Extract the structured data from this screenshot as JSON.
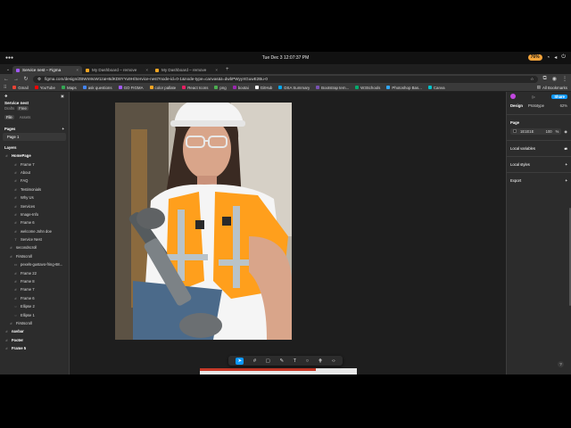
{
  "system": {
    "clock": "Tue Dec 3  12:07:37 PM",
    "battery": "76%"
  },
  "browser": {
    "tabs": [
      {
        "title": "Service nest – Figma",
        "favicon_color": "#a259ff",
        "active": true
      },
      {
        "title": "My Dashboard – remove",
        "favicon_color": "#f5a623",
        "active": false
      },
      {
        "title": "My Dashboard – remove",
        "favicon_color": "#f5a623",
        "active": false
      }
    ],
    "new_tab": "+",
    "url": "figma.com/design/ZBWm9oW1zaH6dKD8YYu9H/Service-nest?node-id=0-1&node-type=canvas&t=dwbPWyyXGuwE2Bu-0",
    "bookmarks": [
      {
        "label": "Gmail",
        "color": "#ea4335"
      },
      {
        "label": "YouTube",
        "color": "#ff0000"
      },
      {
        "label": "Maps",
        "color": "#34a853"
      },
      {
        "label": "ask questions",
        "color": "#4285f4"
      },
      {
        "label": "GO FIGMA",
        "color": "#a259ff"
      },
      {
        "label": "color pallate",
        "color": "#f5a623"
      },
      {
        "label": "React Icons",
        "color": "#e91e63"
      },
      {
        "label": "png",
        "color": "#4caf50"
      },
      {
        "label": "bootai",
        "color": "#9c27b0"
      },
      {
        "label": "GitHub",
        "color": "#ffffff"
      },
      {
        "label": "DSA Summary",
        "color": "#03a9f4"
      },
      {
        "label": "Bootstrap tem...",
        "color": "#7952b3"
      },
      {
        "label": "W3Schools",
        "color": "#04aa6d"
      },
      {
        "label": "Photoshop Bas...",
        "color": "#31a8ff"
      },
      {
        "label": "Canva",
        "color": "#00c4cc"
      }
    ],
    "all_bookmarks": "All Bookmarks"
  },
  "left_panel": {
    "file_name": "Service nest",
    "file_sub": "Drafts",
    "file_badge": "Free",
    "tabs": [
      "File",
      "Assets"
    ],
    "pages_label": "Pages",
    "pages_add": "+",
    "page": "Page 1",
    "layers_label": "Layers",
    "layers": [
      {
        "name": "HomePage",
        "indent": 0,
        "bold": true,
        "icon": "#"
      },
      {
        "name": "Frame 7",
        "indent": 2,
        "bold": false,
        "icon": "#"
      },
      {
        "name": "About",
        "indent": 2,
        "bold": false,
        "icon": "#"
      },
      {
        "name": "FAQ",
        "indent": 2,
        "bold": false,
        "icon": "#"
      },
      {
        "name": "Testimonials",
        "indent": 2,
        "bold": false,
        "icon": "#"
      },
      {
        "name": "Why Us",
        "indent": 2,
        "bold": false,
        "icon": "#"
      },
      {
        "name": "Services",
        "indent": 2,
        "bold": false,
        "icon": "#"
      },
      {
        "name": "Image-Info",
        "indent": 2,
        "bold": false,
        "icon": "#"
      },
      {
        "name": "Frame 6",
        "indent": 2,
        "bold": false,
        "icon": "#"
      },
      {
        "name": "welcome John doe",
        "indent": 2,
        "bold": false,
        "icon": "#"
      },
      {
        "name": "Service Nest",
        "indent": 2,
        "bold": false,
        "icon": "T"
      },
      {
        "name": "secondscroll",
        "indent": 1,
        "bold": false,
        "icon": "#"
      },
      {
        "name": "Firstscroll",
        "indent": 1,
        "bold": false,
        "icon": "#"
      },
      {
        "name": "pexels-gustavo-fring-68...",
        "indent": 2,
        "bold": false,
        "icon": "▭"
      },
      {
        "name": "Frame 22",
        "indent": 2,
        "bold": false,
        "icon": "#"
      },
      {
        "name": "Frame 8",
        "indent": 2,
        "bold": false,
        "icon": "#"
      },
      {
        "name": "Frame 7",
        "indent": 2,
        "bold": false,
        "icon": "#"
      },
      {
        "name": "Frame 6",
        "indent": 2,
        "bold": false,
        "icon": "#"
      },
      {
        "name": "Ellipse 2",
        "indent": 2,
        "bold": false,
        "icon": "○"
      },
      {
        "name": "Ellipse 1",
        "indent": 2,
        "bold": false,
        "icon": "○"
      },
      {
        "name": "Firstscroll",
        "indent": 1,
        "bold": false,
        "icon": "#"
      },
      {
        "name": "navbar",
        "indent": 0,
        "bold": true,
        "icon": "#"
      },
      {
        "name": "Footer",
        "indent": 0,
        "bold": true,
        "icon": "#"
      },
      {
        "name": "Frame 5",
        "indent": 0,
        "bold": true,
        "icon": "#"
      }
    ]
  },
  "right_panel": {
    "share": "Share",
    "tabs": [
      "Design",
      "Prototype"
    ],
    "zoom": "62%",
    "page_label": "Page",
    "page_color": "1E1E1E",
    "page_opacity": "100",
    "page_opacity_unit": "%",
    "local_variables": "Local variables",
    "local_styles": "Local styles",
    "export": "Export",
    "help": "?"
  },
  "canvas": {
    "toolbar_icons": [
      "move-tool",
      "frame-tool",
      "shape-tool",
      "pen-tool",
      "text-tool",
      "comment-tool",
      "actions-tool",
      "dev-mode-tool"
    ]
  }
}
